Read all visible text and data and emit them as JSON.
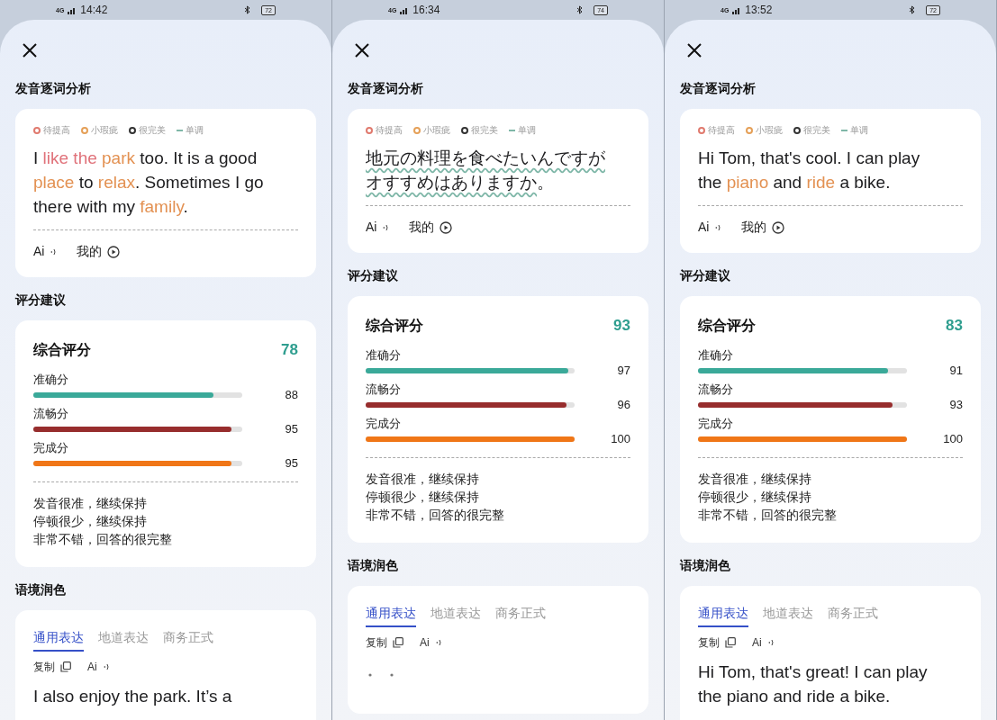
{
  "phones": [
    {
      "status_bar": {
        "network": "4G",
        "time": "14:42",
        "battery": "72"
      },
      "analysis": {
        "title": "发音逐词分析",
        "legend": [
          {
            "label": "待提高",
            "kind": "ring",
            "color": "#e07a6e"
          },
          {
            "label": "小瑕疵",
            "kind": "ring",
            "color": "#e5a058"
          },
          {
            "label": "很完美",
            "kind": "ring",
            "color": "#333333"
          },
          {
            "label": "单调",
            "kind": "dash",
            "color": "#7fb7a8"
          }
        ],
        "segments": [
          {
            "text": "I ",
            "kind": "normal"
          },
          {
            "text": "like the ",
            "kind": "improve"
          },
          {
            "text": "park",
            "kind": "minor"
          },
          {
            "text": " too. It is a good ",
            "kind": "normal"
          },
          {
            "text": "place",
            "kind": "minor"
          },
          {
            "text": " to ",
            "kind": "normal"
          },
          {
            "text": "relax",
            "kind": "minor"
          },
          {
            "text": ". Sometimes I go there with my ",
            "kind": "normal"
          },
          {
            "text": "family",
            "kind": "minor"
          },
          {
            "text": ".",
            "kind": "normal"
          }
        ],
        "ai_label": "Ai",
        "mine_label": "我的"
      },
      "scores": {
        "title": "评分建议",
        "overall_label": "综合评分",
        "overall": "78",
        "metrics": [
          {
            "label": "准确分",
            "level": 0.86,
            "value": "88",
            "color": "#3aa999"
          },
          {
            "label": "流畅分",
            "level": 0.95,
            "value": "95",
            "color": "#972d2d"
          },
          {
            "label": "完成分",
            "level": 0.95,
            "value": "95",
            "color": "#f07617"
          }
        ],
        "comments": [
          "发音很准，继续保持",
          "停顿很少，继续保持",
          "非常不错，回答的很完整"
        ]
      },
      "polish": {
        "title": "语境润色",
        "tabs": [
          {
            "label": "通用表达",
            "selected": true
          },
          {
            "label": "地道表达",
            "selected": false
          },
          {
            "label": "商务正式",
            "selected": false
          }
        ],
        "copy_label": "复制",
        "ai_label": "Ai",
        "text": "I also enjoy the park. It’s a",
        "loading": false
      }
    },
    {
      "status_bar": {
        "network": "4G",
        "time": "16:34",
        "battery": "74"
      },
      "analysis": {
        "title": "发音逐词分析",
        "legend": [
          {
            "label": "待提高",
            "kind": "ring",
            "color": "#e07a6e"
          },
          {
            "label": "小瑕疵",
            "kind": "ring",
            "color": "#e5a058"
          },
          {
            "label": "很完美",
            "kind": "ring",
            "color": "#333333"
          },
          {
            "label": "单调",
            "kind": "dash",
            "color": "#7fb7a8"
          }
        ],
        "segments": [
          {
            "text": "地元の料理を食べたいんですがオすすめはありますか",
            "kind": "monotone"
          },
          {
            "text": "。",
            "kind": "normal"
          }
        ],
        "ai_label": "Ai",
        "mine_label": "我的"
      },
      "scores": {
        "title": "评分建议",
        "overall_label": "综合评分",
        "overall": "93",
        "metrics": [
          {
            "label": "准确分",
            "level": 0.97,
            "value": "97",
            "color": "#3aa999"
          },
          {
            "label": "流畅分",
            "level": 0.96,
            "value": "96",
            "color": "#972d2d"
          },
          {
            "label": "完成分",
            "level": 1.0,
            "value": "100",
            "color": "#f07617"
          }
        ],
        "comments": [
          "发音很准，继续保持",
          "停顿很少，继续保持",
          "非常不错，回答的很完整"
        ]
      },
      "polish": {
        "title": "语境润色",
        "tabs": [
          {
            "label": "通用表达",
            "selected": true
          },
          {
            "label": "地道表达",
            "selected": false
          },
          {
            "label": "商务正式",
            "selected": false
          }
        ],
        "copy_label": "复制",
        "ai_label": "Ai",
        "loading": true
      }
    },
    {
      "status_bar": {
        "network": "4G",
        "time": "13:52",
        "battery": "72"
      },
      "analysis": {
        "title": "发音逐词分析",
        "legend": [
          {
            "label": "待提高",
            "kind": "ring",
            "color": "#e07a6e"
          },
          {
            "label": "小瑕疵",
            "kind": "ring",
            "color": "#e5a058"
          },
          {
            "label": "很完美",
            "kind": "ring",
            "color": "#333333"
          },
          {
            "label": "单调",
            "kind": "dash",
            "color": "#7fb7a8"
          }
        ],
        "segments": [
          {
            "text": "Hi Tom, that's cool. I can play the ",
            "kind": "normal"
          },
          {
            "text": "piano",
            "kind": "minor"
          },
          {
            "text": " and ",
            "kind": "normal"
          },
          {
            "text": "ride",
            "kind": "minor"
          },
          {
            "text": " a bike.",
            "kind": "normal"
          }
        ],
        "ai_label": "Ai",
        "mine_label": "我的"
      },
      "scores": {
        "title": "评分建议",
        "overall_label": "综合评分",
        "overall": "83",
        "metrics": [
          {
            "label": "准确分",
            "level": 0.91,
            "value": "91",
            "color": "#3aa999"
          },
          {
            "label": "流畅分",
            "level": 0.93,
            "value": "93",
            "color": "#972d2d"
          },
          {
            "label": "完成分",
            "level": 1.0,
            "value": "100",
            "color": "#f07617"
          }
        ],
        "comments": [
          "发音很准，继续保持",
          "停顿很少，继续保持",
          "非常不错，回答的很完整"
        ]
      },
      "polish": {
        "title": "语境润色",
        "tabs": [
          {
            "label": "通用表达",
            "selected": true
          },
          {
            "label": "地道表达",
            "selected": false
          },
          {
            "label": "商务正式",
            "selected": false
          }
        ],
        "copy_label": "复制",
        "ai_label": "Ai",
        "text": "Hi Tom, that's great! I can play the piano and ride a bike.",
        "loading": false
      }
    }
  ]
}
